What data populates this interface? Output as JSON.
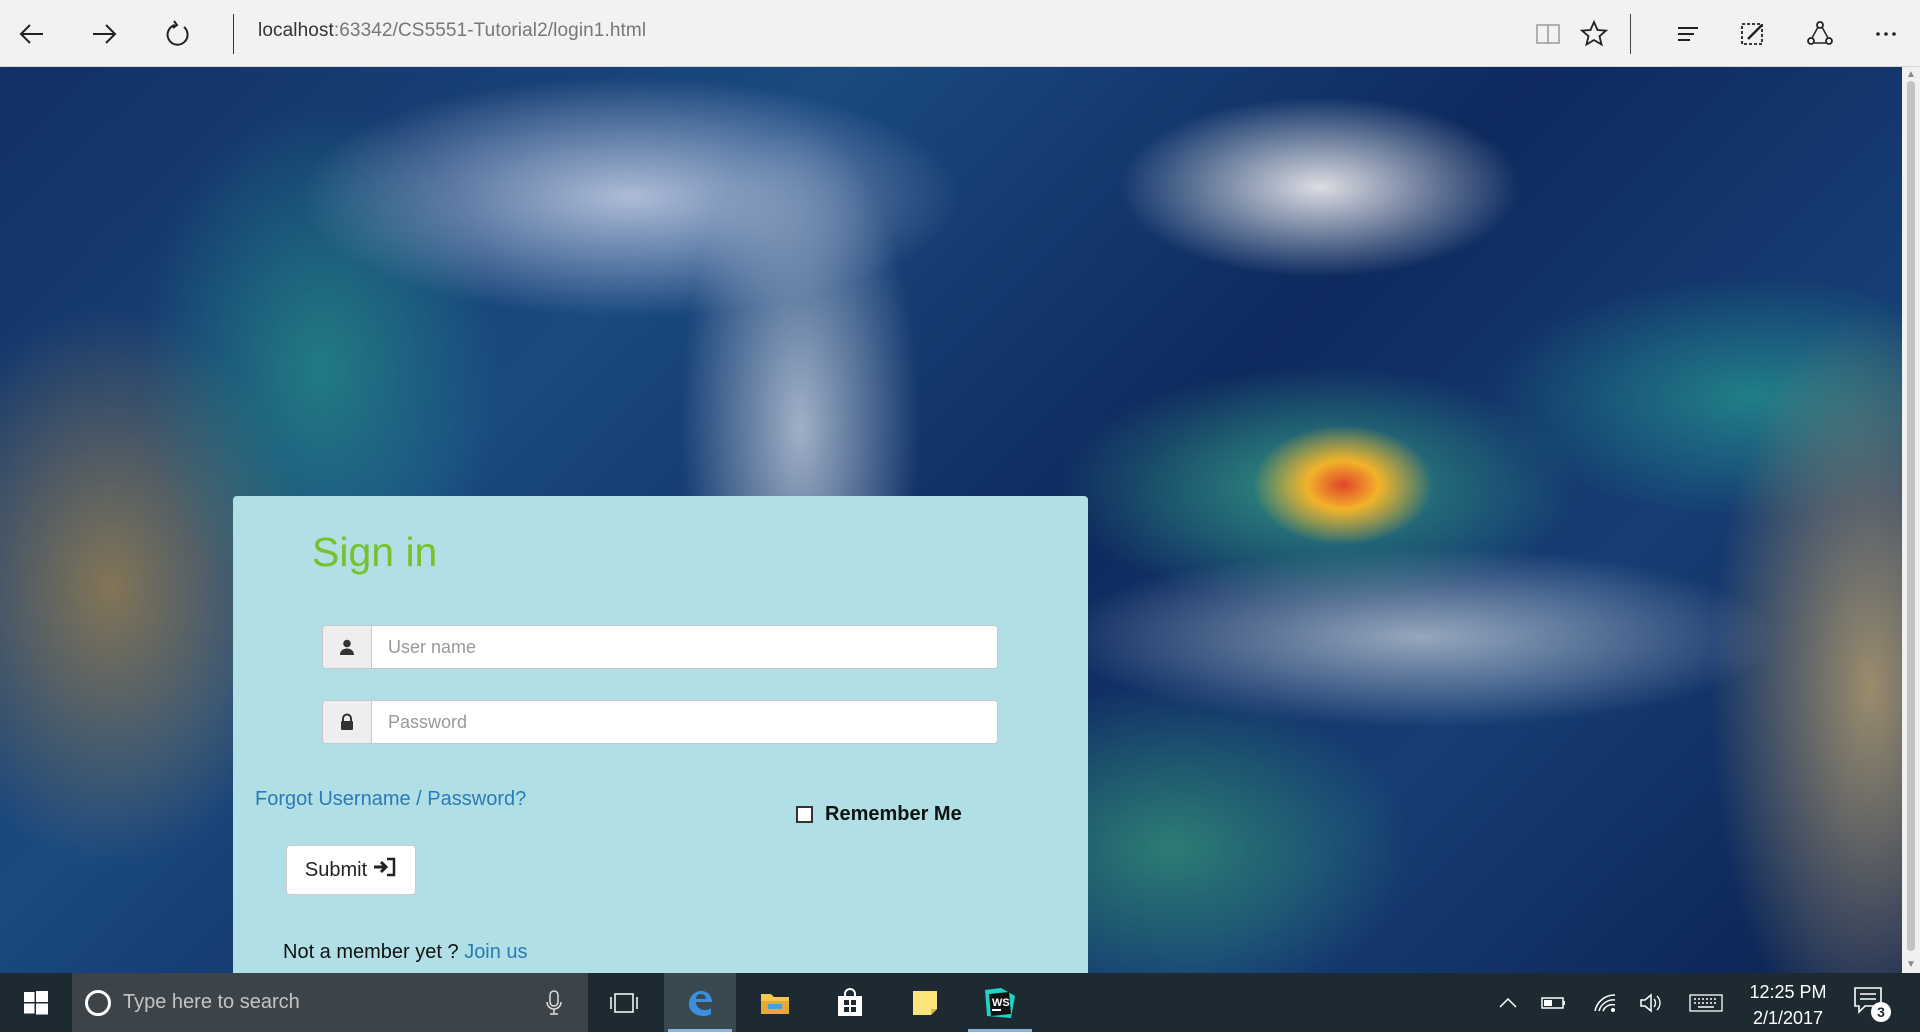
{
  "browser": {
    "address_host": "localhost",
    "address_rest": ":63342/CS5551-Tutorial2/login1.html",
    "icons": [
      "back-arrow-icon",
      "forward-arrow-icon",
      "refresh-icon",
      "reading-view-icon",
      "favorite-star-icon",
      "hub-icon",
      "web-note-icon",
      "share-icon",
      "more-dots-icon"
    ]
  },
  "login": {
    "title": "Sign in",
    "username_placeholder": "User name",
    "password_placeholder": "Password",
    "forgot_link": "Forgot Username / Password?",
    "remember_label": "Remember Me",
    "submit_label": "Submit",
    "member_prompt": "Not a member yet ? ",
    "join_link": "Join us",
    "colors": {
      "card_bg": "#b0e0e6",
      "title": "#77c12c",
      "link": "#2a7ab8"
    }
  },
  "taskbar": {
    "search_placeholder": "Type here to search",
    "apps": [
      "task-view-icon",
      "edge-browser-icon",
      "file-explorer-icon",
      "store-icon",
      "sticky-notes-icon",
      "webstorm-icon"
    ],
    "clock_time": "12:25 PM",
    "clock_date": "2/1/2017",
    "notification_count": "3"
  }
}
